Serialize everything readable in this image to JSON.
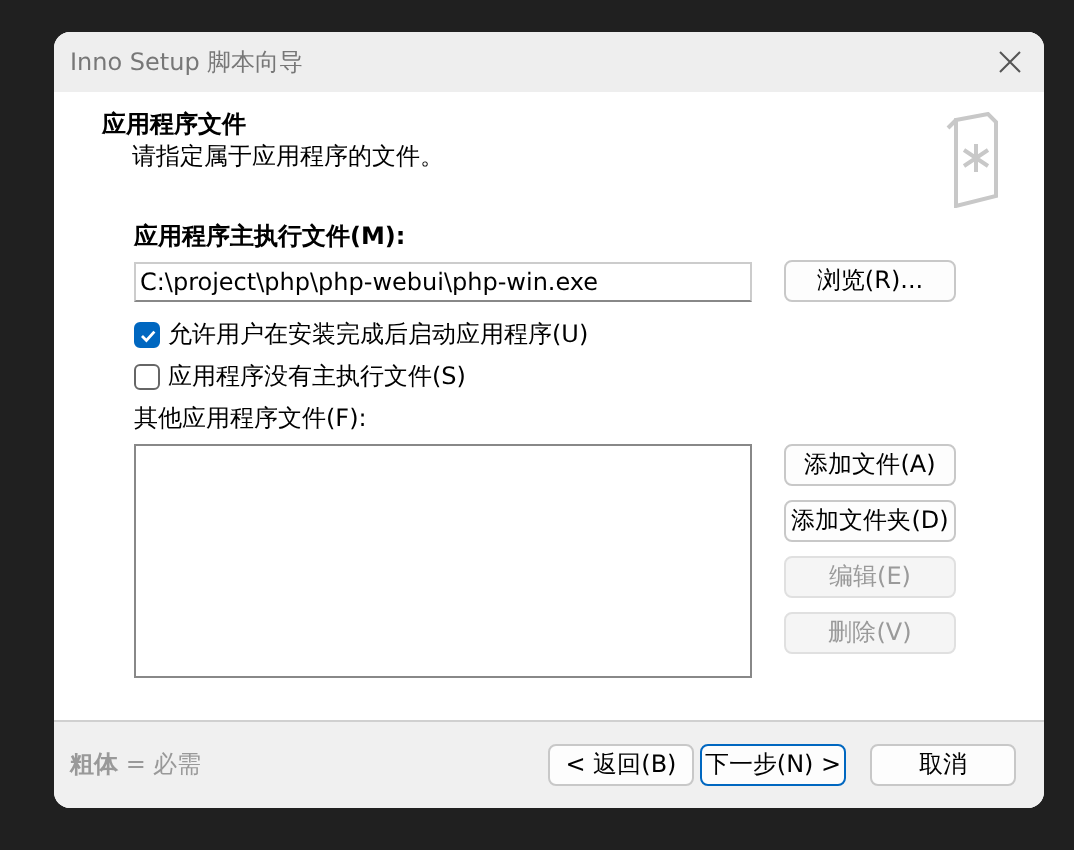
{
  "window": {
    "title": "Inno Setup 脚本向导"
  },
  "header": {
    "title": "应用程序文件",
    "subtitle": "请指定属于应用程序的文件。"
  },
  "main_exe": {
    "label": "应用程序主执行文件(M):",
    "value": "C:\\project\\php\\php-webui\\php-win.exe",
    "browse_button": "浏览(R)..."
  },
  "options": [
    {
      "label": "允许用户在安装完成后启动应用程序(U)",
      "checked": true
    },
    {
      "label": "应用程序没有主执行文件(S)",
      "checked": false
    }
  ],
  "other_files": {
    "label": "其他应用程序文件(F):",
    "buttons": [
      {
        "label": "添加文件(A)",
        "disabled": false
      },
      {
        "label": "添加文件夹(D)",
        "disabled": false
      },
      {
        "label": "编辑(E)",
        "disabled": true
      },
      {
        "label": "删除(V)",
        "disabled": true
      }
    ]
  },
  "footer": {
    "legend": "**粗体** = 必需",
    "buttons": [
      {
        "label": "< 返回(B)",
        "default": false
      },
      {
        "label": "下一步(N) >",
        "default": true
      },
      {
        "label": "取消",
        "default": false
      }
    ]
  }
}
